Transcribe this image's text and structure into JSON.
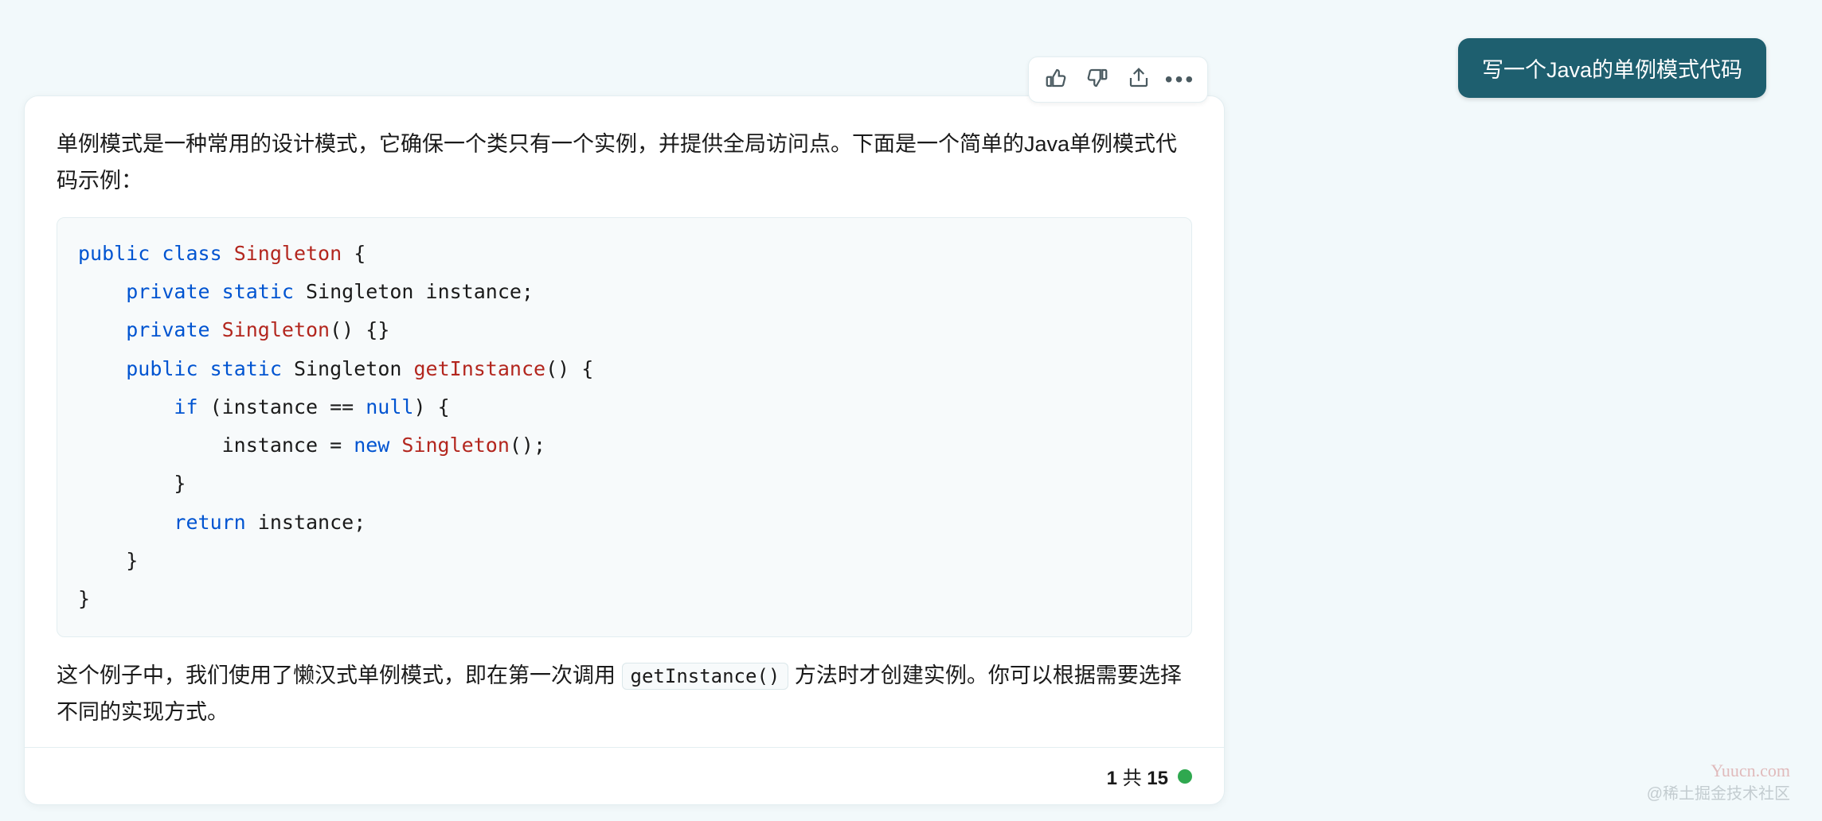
{
  "user_message": "写一个Java的单例模式代码",
  "assistant": {
    "intro": "单例模式是一种常用的设计模式，它确保一个类只有一个实例，并提供全局访问点。下面是一个简单的Java单例模式代码示例：",
    "code": {
      "tokens": [
        {
          "t": "public",
          "c": "k-blue"
        },
        {
          "t": " "
        },
        {
          "t": "class",
          "c": "k-blue"
        },
        {
          "t": " "
        },
        {
          "t": "Singleton",
          "c": "k-red"
        },
        {
          "t": " {\n"
        },
        {
          "t": "    "
        },
        {
          "t": "private",
          "c": "k-blue"
        },
        {
          "t": " "
        },
        {
          "t": "static",
          "c": "k-blue"
        },
        {
          "t": " Singleton instance;\n"
        },
        {
          "t": "    "
        },
        {
          "t": "private",
          "c": "k-blue"
        },
        {
          "t": " "
        },
        {
          "t": "Singleton",
          "c": "k-red"
        },
        {
          "t": "() {}\n"
        },
        {
          "t": "    "
        },
        {
          "t": "public",
          "c": "k-blue"
        },
        {
          "t": " "
        },
        {
          "t": "static",
          "c": "k-blue"
        },
        {
          "t": " Singleton "
        },
        {
          "t": "getInstance",
          "c": "k-func"
        },
        {
          "t": "() {\n"
        },
        {
          "t": "        "
        },
        {
          "t": "if",
          "c": "k-blue"
        },
        {
          "t": " (instance == "
        },
        {
          "t": "null",
          "c": "k-blue"
        },
        {
          "t": ") {\n"
        },
        {
          "t": "            instance = "
        },
        {
          "t": "new",
          "c": "k-blue"
        },
        {
          "t": " "
        },
        {
          "t": "Singleton",
          "c": "k-red"
        },
        {
          "t": "();\n"
        },
        {
          "t": "        }\n"
        },
        {
          "t": "        "
        },
        {
          "t": "return",
          "c": "k-blue"
        },
        {
          "t": " instance;\n"
        },
        {
          "t": "    }\n"
        },
        {
          "t": "}"
        }
      ]
    },
    "explain_before": "这个例子中，我们使用了懒汉式单例模式，即在第一次调用 ",
    "explain_inline": "getInstance()",
    "explain_after": " 方法时才创建实例。你可以根据需要选择不同的实现方式。"
  },
  "footer": {
    "current": "1",
    "sep": " 共 ",
    "total": "15"
  },
  "watermarks": {
    "site": "Yuucn.com",
    "community": "@稀土掘金技术社区"
  }
}
